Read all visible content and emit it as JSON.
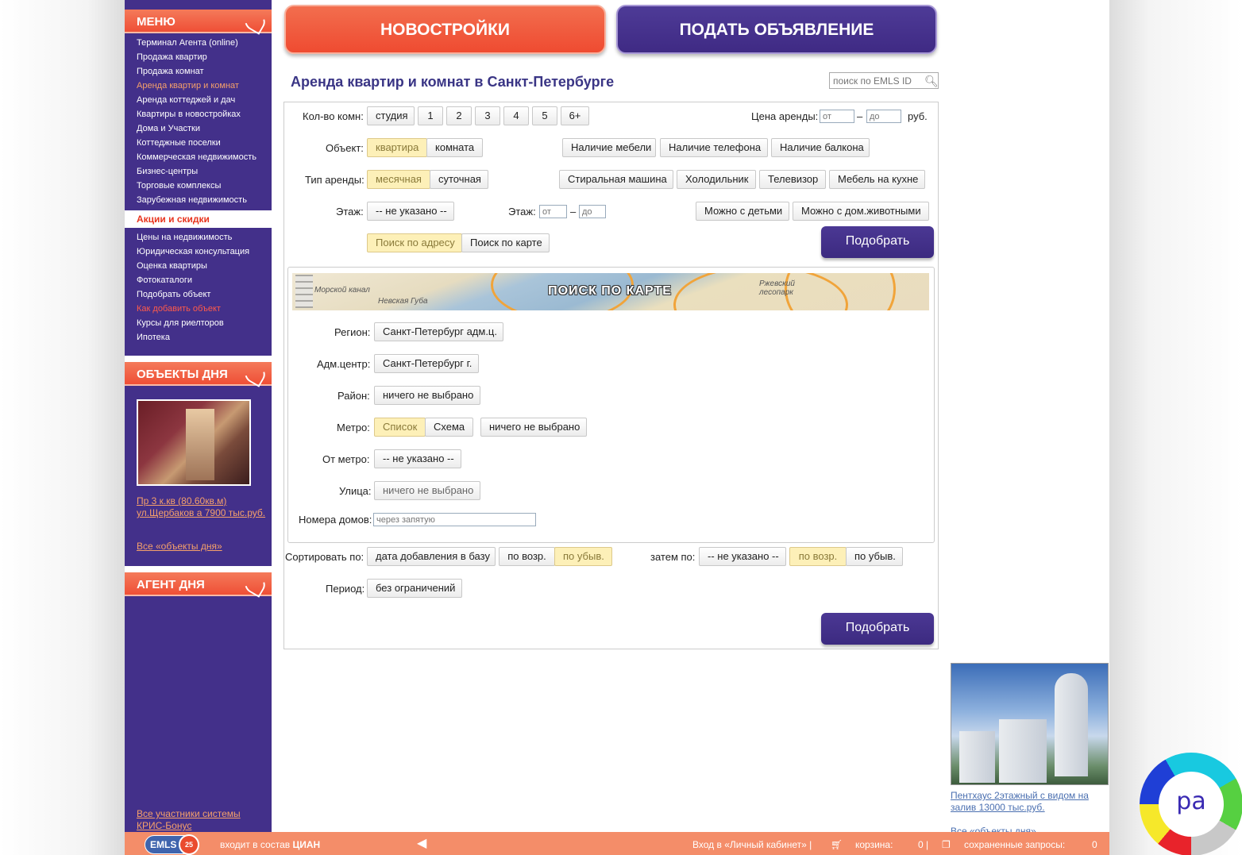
{
  "top_buttons": {
    "new_buildings": "НОВОСТРОЙКИ",
    "post_ad": "ПОДАТЬ ОБЪЯВЛЕНИЕ"
  },
  "page_title": "Аренда квартир и комнат в Санкт-Петербурге",
  "emls_search": {
    "placeholder": "поиск по EMLS ID"
  },
  "sidebar": {
    "menu_title": "МЕНЮ",
    "menu_items": [
      "Терминал Агента (online)",
      "Продажа квартир",
      "Продажа комнат",
      "Аренда квартир и комнат",
      "Аренда коттеджей и дач",
      "Квартиры в новостройках",
      "Дома и Участки",
      "Коттеджные поселки",
      "Коммерческая недвижимость",
      "Бизнес-центры",
      "Торговые комплексы",
      "Зарубежная недвижимость"
    ],
    "promo": "Акции и скидки",
    "menu_items2": [
      "Цены на недвижимость",
      "Юридическая консультация",
      "Оценка квартиры",
      "Фотокаталоги",
      "Подобрать объект",
      "Как добавить объект",
      "Курсы для риелторов",
      "Ипотека"
    ],
    "objects_title": "ОБЪЕКТЫ ДНЯ",
    "object_link": "Пр 3 к.кв (80.60кв.м) ул.Щербаков а 7900 тыс.руб.",
    "all_objects": "Все «объекты дня»",
    "agent_title": "АГЕНТ ДНЯ",
    "all_members": "Все участники системы КРИС-Бонус"
  },
  "form": {
    "rooms_label": "Кол-во комн:",
    "rooms": [
      "студия",
      "1",
      "2",
      "3",
      "4",
      "5",
      "6+"
    ],
    "price_label": "Цена аренды:",
    "price_from": "от",
    "price_dash": "–",
    "price_to": "до",
    "price_unit": "руб.",
    "object_label": "Объект:",
    "object_options": [
      "квартира",
      "комната"
    ],
    "amenities1": [
      "Наличие мебели",
      "Наличие телефона",
      "Наличие балкона"
    ],
    "rent_type_label": "Тип аренды:",
    "rent_types": [
      "месячная",
      "суточная"
    ],
    "amenities2": [
      "Стиральная машина",
      "Холодильник",
      "Телевизор",
      "Мебель на кухне"
    ],
    "floor_label": "Этаж:",
    "floor_value": "-- не указано --",
    "floor_label2": "Этаж:",
    "floor_from": "от",
    "floor_dash": "–",
    "floor_to": "до",
    "allow": [
      "Можно с детьми",
      "Можно с дом.животными"
    ],
    "search_modes": [
      "Поиск по адресу",
      "Поиск по карте"
    ],
    "submit": "Подобрать",
    "map_title": "ПОИСК ПО КАРТЕ",
    "map_labels": [
      "Ржевский лесопарк",
      "Невская Губа",
      "Морской канал"
    ],
    "region_label": "Регион:",
    "region_value": "Санкт-Петербург адм.ц.",
    "admcenter_label": "Адм.центр:",
    "admcenter_value": "Санкт-Петербург г.",
    "district_label": "Район:",
    "district_value": "ничего не выбрано",
    "metro_label": "Метро:",
    "metro_modes": [
      "Список",
      "Схема"
    ],
    "metro_value": "ничего не выбрано",
    "from_metro_label": "От метро:",
    "from_metro_value": "-- не указано --",
    "street_label": "Улица:",
    "street_value": "ничего не выбрано",
    "houses_label": "Номера домов:",
    "houses_placeholder": "через запятую",
    "sort_label": "Сортировать по:",
    "sort_value": "дата добавления в базу",
    "sort_dirs": [
      "по возр.",
      "по убыв."
    ],
    "then_label": "затем по:",
    "then_value": "-- не указано --",
    "then_dirs": [
      "по возр.",
      "по убыв."
    ],
    "period_label": "Период:",
    "period_value": "без ограничений"
  },
  "ad": {
    "link": "Пентхаус 2этажный с видом на залив 13000 тыс.руб.",
    "all": "Все «объекты дня»"
  },
  "footer": {
    "logo": "EMLS",
    "logo_badge": "25",
    "part_of": "входит в состав",
    "cian": "ЦИАН",
    "login": "Вход в «Личный кабинет» |",
    "cart_label": "корзина:",
    "cart_count": "0 |",
    "saved_label": "сохраненные запросы:",
    "saved_count": "0"
  },
  "widget": {
    "text": "pa"
  },
  "colors": {
    "purple": "#43308a",
    "orange": "#ef4f36",
    "footer": "#f48d69",
    "selected": "#fdf0b8"
  }
}
